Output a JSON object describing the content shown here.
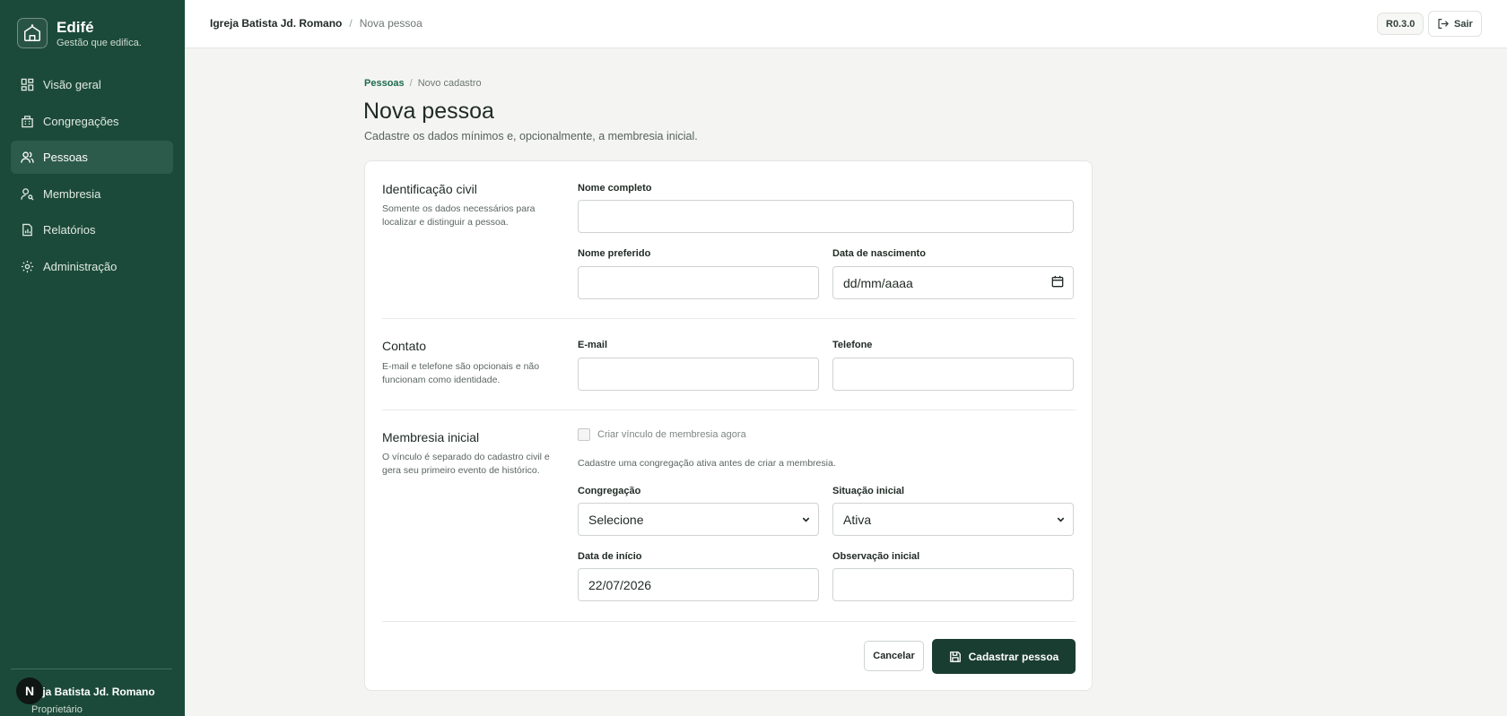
{
  "sidebar": {
    "brand_name": "Edifé",
    "brand_tagline": "Gestão que edifica.",
    "items": [
      {
        "label": "Visão geral",
        "icon": "grid-icon"
      },
      {
        "label": "Congregações",
        "icon": "building-icon"
      },
      {
        "label": "Pessoas",
        "icon": "users-icon"
      },
      {
        "label": "Membresia",
        "icon": "user-key-icon"
      },
      {
        "label": "Relatórios",
        "icon": "report-icon"
      },
      {
        "label": "Administração",
        "icon": "gear-icon"
      }
    ],
    "active_item": "Pessoas",
    "user": {
      "avatar": "N",
      "org": "Igreja Batista Jd. Romano",
      "org_visible": "reja Batista Jd. Romano",
      "role": "Proprietário"
    }
  },
  "topbar": {
    "org": "Igreja Batista Jd. Romano",
    "separator": "/",
    "page": "Nova pessoa",
    "version": "R0.3.0",
    "logout_label": "Sair"
  },
  "header": {
    "breadcrumb_link": "Pessoas",
    "breadcrumb_sep": "/",
    "breadcrumb_current": "Novo cadastro",
    "title": "Nova pessoa",
    "subtitle": "Cadastre os dados mínimos e, opcionalmente, a membresia inicial."
  },
  "form": {
    "civil": {
      "title": "Identificação civil",
      "desc": "Somente os dados necessários para localizar e distinguir a pessoa.",
      "full_name_label": "Nome completo",
      "full_name_value": "",
      "preferred_name_label": "Nome preferido",
      "preferred_name_value": "",
      "birth_label": "Data de nascimento",
      "birth_placeholder": "dd/mm/aaaa"
    },
    "contact": {
      "title": "Contato",
      "desc": "E-mail e telefone são opcionais e não funcionam como identidade.",
      "email_label": "E-mail",
      "email_value": "",
      "phone_label": "Telefone",
      "phone_value": ""
    },
    "membership": {
      "title": "Membresia inicial",
      "desc": "O vínculo é separado do cadastro civil e gera seu primeiro evento de histórico.",
      "checkbox_label": "Criar vínculo de membresia agora",
      "checkbox_checked": false,
      "hint": "Cadastre uma congregação ativa antes de criar a membresia.",
      "congregation_label": "Congregação",
      "congregation_value": "Selecione",
      "status_label": "Situação inicial",
      "status_value": "Ativa",
      "start_label": "Data de início",
      "start_value": "22/07/2026",
      "note_label": "Observação inicial",
      "note_value": ""
    },
    "actions": {
      "cancel": "Cancelar",
      "submit": "Cadastrar pessoa"
    }
  },
  "colors": {
    "sidebar_bg": "#1c4a3a",
    "sidebar_active": "#2d5b4b",
    "primary_button": "#1a3d31",
    "link": "#1c6b4a",
    "page_bg": "#f4f5f3"
  }
}
